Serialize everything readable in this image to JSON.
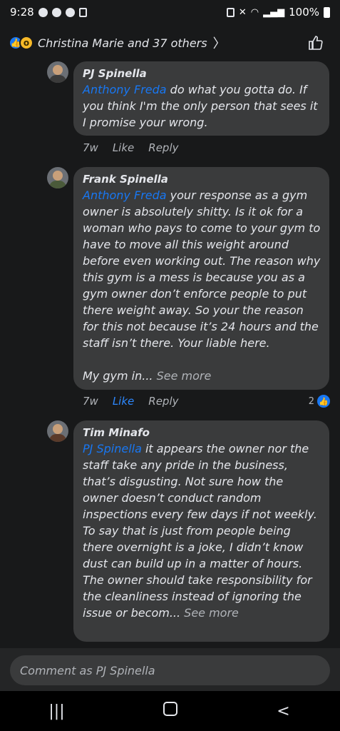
{
  "status_bar": {
    "time": "9:28",
    "battery": "100%"
  },
  "reactions": {
    "summary": "Christina Marie and 37 others"
  },
  "comments": [
    {
      "author": "PJ Spinella",
      "mention": "Anthony Freda",
      "text": " do what you gotta do. If you think I'm the only person that sees it I promise your wrong.",
      "see_more": "",
      "time": "7w",
      "like": "Like",
      "reply": "Reply",
      "reaction_count": ""
    },
    {
      "author": "Frank Spinella",
      "mention": "Anthony Freda",
      "text": " your response as a gym owner is absolutely shitty. Is it ok for a woman who pays to come to your gym to have to move all this weight around before even working out. The reason why this gym is a mess is because you as a gym owner don’t enforce people to put there weight away. So your the reason for this not because it’s 24 hours and the staff isn’t there. Your liable here.\n\nMy gym in... ",
      "see_more": "See more",
      "time": "7w",
      "like": "Like",
      "reply": "Reply",
      "reaction_count": "2"
    },
    {
      "author": "Tim Minafo",
      "mention": "PJ Spinella",
      "text": " it appears the owner nor the staff take any pride in the business, that’s disgusting. Not sure how the owner doesn’t conduct random inspections every few days if not weekly. To say that is just from people being there overnight is a joke, I didn’t know dust can build up in a matter of hours. The owner should take responsibility for the cleanliness instead of ignoring the issue or becom... ",
      "see_more": "See more",
      "time": "",
      "like": "",
      "reply": "",
      "reaction_count": ""
    }
  ],
  "composer": {
    "placeholder": "Comment as PJ Spinella"
  },
  "colors": {
    "background": "#18191a",
    "bubble": "#3a3b3c",
    "link": "#1877f2"
  }
}
